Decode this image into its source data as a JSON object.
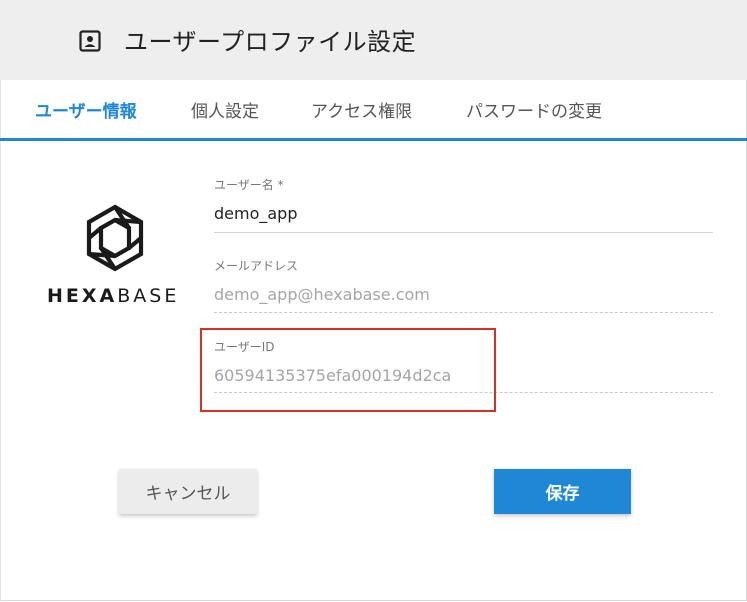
{
  "header": {
    "title": "ユーザープロファイル設定",
    "icon": "contact-card-icon"
  },
  "tabs": [
    {
      "label": "ユーザー情報",
      "active": true
    },
    {
      "label": "個人設定",
      "active": false
    },
    {
      "label": "アクセス権限",
      "active": false
    },
    {
      "label": "パスワードの変更",
      "active": false
    }
  ],
  "logo": {
    "text_bold": "HEXA",
    "text_light": "BASE"
  },
  "form": {
    "username": {
      "label": "ユーザー名 *",
      "value": "demo_app"
    },
    "email": {
      "label": "メールアドレス",
      "value": "demo_app@hexabase.com"
    },
    "user_id": {
      "label": "ユーザーID",
      "value": "60594135375efa000194d2ca"
    }
  },
  "buttons": {
    "cancel": "キャンセル",
    "save": "保存"
  },
  "colors": {
    "accent": "#1e88d7",
    "highlight_border": "#d93025",
    "header_bg": "#eeeeee"
  }
}
